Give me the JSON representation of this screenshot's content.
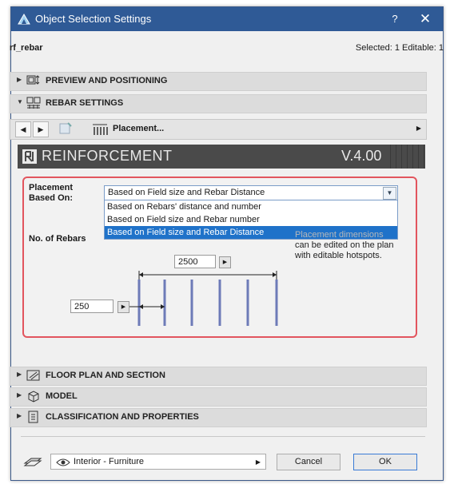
{
  "window": {
    "title": "Object Selection Settings",
    "help_label": "?",
    "close_label": "✕",
    "accent": "#2f5a96"
  },
  "object": {
    "name": "rf_rebar",
    "selection_info": "Selected: 1 Editable: 1"
  },
  "sections": {
    "preview": "PREVIEW AND POSITIONING",
    "rebar": "REBAR SETTINGS",
    "floor": "FLOOR PLAN AND SECTION",
    "model": "MODEL",
    "classification": "CLASSIFICATION AND PROPERTIES"
  },
  "nav": {
    "prev_label": "◀",
    "next_label": "▶",
    "page_label": "Placement...",
    "page_arrow": "▶"
  },
  "banner": {
    "title": "REINFORCEMENT",
    "version": "V.4.00"
  },
  "placement": {
    "label_line1": "Placement",
    "label_line2": "Based On:",
    "selected": "Based on Field size and Rebar Distance",
    "options": [
      "Based on Rebars' distance and number",
      "Based on Field size and Rebar number",
      "Based on Field size and Rebar Distance"
    ],
    "selected_index": 2,
    "highlight_color": "#1f72c9"
  },
  "rebars": {
    "label": "No. of Rebars",
    "hint_line1": "Placement dimensions",
    "hint_line2": "can be edited on the plan",
    "hint_line3": "with editable hotspots.",
    "field_size": "2500",
    "rebar_distance": "250"
  },
  "footer": {
    "layer": "Interior - Furniture",
    "cancel_label": "Cancel",
    "ok_label": "OK"
  }
}
